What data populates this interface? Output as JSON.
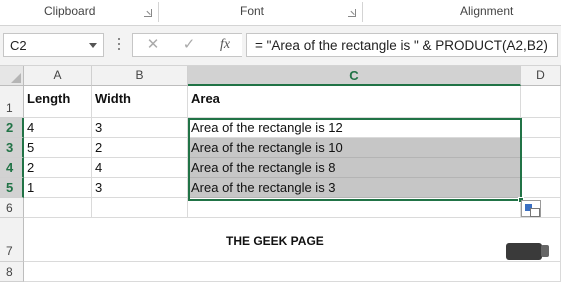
{
  "ribbon": {
    "groups": [
      "Clipboard",
      "Font",
      "Alignment"
    ]
  },
  "formula_bar": {
    "name_box": "C2",
    "cancel_icon": "close-icon",
    "enter_icon": "check-icon",
    "fx_label": "fx",
    "formula": "= \"Area of the rectangle is \" & PRODUCT(A2,B2)"
  },
  "sheet": {
    "columns": [
      "A",
      "B",
      "C",
      "D"
    ],
    "rows": [
      "1",
      "2",
      "3",
      "4",
      "5",
      "6",
      "7",
      "8"
    ],
    "selected_column": "C",
    "active_cell": "C2",
    "selected_range": "C2:C5",
    "cells": {
      "A1": "Length",
      "B1": "Width",
      "C1": "Area",
      "A2": "4",
      "B2": "3",
      "C2": "Area of the rectangle is 12",
      "A3": "5",
      "B3": "2",
      "C3": "Area of the rectangle is 10",
      "A4": "2",
      "B4": "4",
      "C4": "Area of the rectangle is 8",
      "A5": "1",
      "B5": "3",
      "C5": "Area of the rectangle is 3"
    }
  },
  "watermark": "THE GEEK PAGE",
  "colors": {
    "accent": "#217346",
    "highlight_fill": "#c6c6c6"
  }
}
